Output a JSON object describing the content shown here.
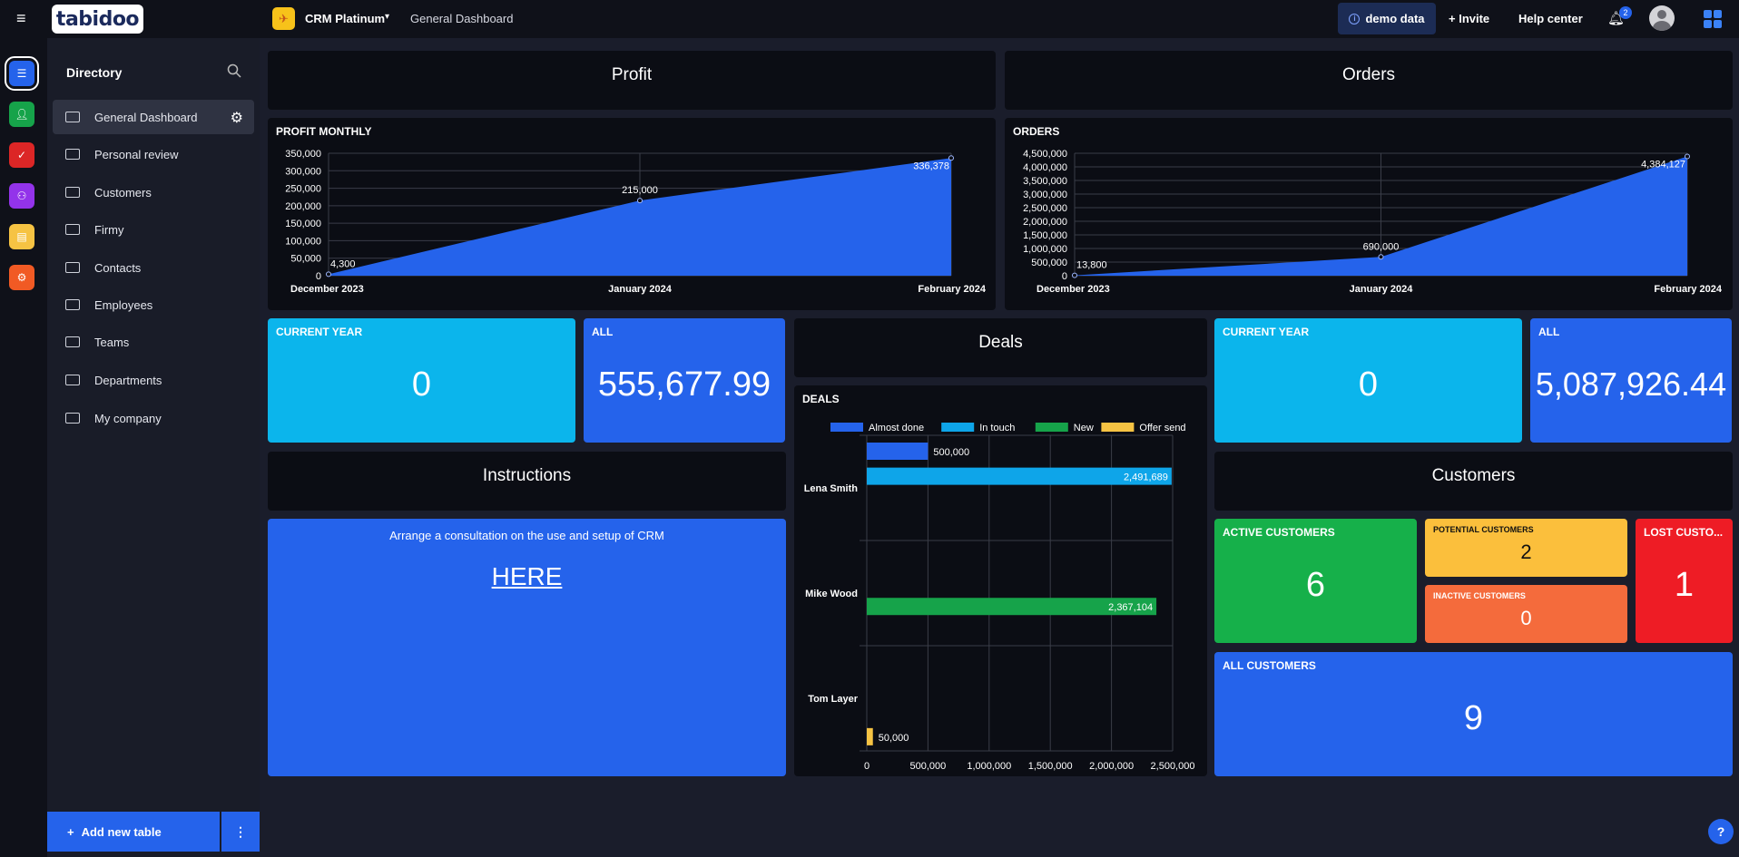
{
  "topbar": {
    "logo_text": "tabidoo",
    "app_name": "CRM Platinum",
    "breadcrumb": "General Dashboard",
    "demo_label": "demo data",
    "invite_label": "+ Invite",
    "help_label": "Help center",
    "notif_count": "2"
  },
  "sidebar": {
    "title": "Directory",
    "items": [
      {
        "label": "General Dashboard"
      },
      {
        "label": "Personal review"
      },
      {
        "label": "Customers"
      },
      {
        "label": "Firmy"
      },
      {
        "label": "Contacts"
      },
      {
        "label": "Employees"
      },
      {
        "label": "Teams"
      },
      {
        "label": "Departments"
      },
      {
        "label": "My company"
      }
    ],
    "add_table_label": "Add new table"
  },
  "rail": {
    "colors": [
      "#2563eb",
      "#16a34a",
      "#dc2626",
      "#9333ea",
      "#f6c343",
      "#f15a24"
    ]
  },
  "sections": {
    "profit_title": "Profit",
    "orders_title": "Orders",
    "deals_title": "Deals",
    "instructions_title": "Instructions",
    "customers_title": "Customers"
  },
  "kpis": {
    "profit_current_label": "CURRENT YEAR",
    "profit_current_value": "0",
    "profit_all_label": "ALL",
    "profit_all_value": "555,677.99",
    "orders_current_label": "CURRENT YEAR",
    "orders_current_value": "0",
    "orders_all_label": "ALL",
    "orders_all_value": "5,087,926.44",
    "active_label": "ACTIVE CUSTOMERS",
    "active_value": "6",
    "potential_label": "POTENTIAL CUSTOMERS",
    "potential_value": "2",
    "inactive_label": "INACTIVE CUSTOMERS",
    "inactive_value": "0",
    "lost_label": "LOST CUSTO...",
    "lost_value": "1",
    "all_customers_label": "ALL CUSTOMERS",
    "all_customers_value": "9"
  },
  "instructions": {
    "text": "Arrange a consultation on the use and setup of CRM",
    "link": "HERE"
  },
  "chart_data": [
    {
      "type": "area",
      "title": "PROFIT MONTHLY",
      "categories": [
        "December 2023",
        "January 2024",
        "February 2024"
      ],
      "values": [
        4300,
        215000,
        336378
      ],
      "value_labels": [
        "4,300",
        "215,000",
        "336,378"
      ],
      "yticks": [
        "0",
        "50,000",
        "100,000",
        "150,000",
        "200,000",
        "250,000",
        "300,000",
        "350,000"
      ],
      "ylim": [
        0,
        350000
      ],
      "color": "#2563eb"
    },
    {
      "type": "area",
      "title": "ORDERS",
      "categories": [
        "December 2023",
        "January 2024",
        "February 2024"
      ],
      "values": [
        13800,
        690000,
        4384127
      ],
      "value_labels": [
        "13,800",
        "690,000",
        "4,384,127"
      ],
      "yticks": [
        "0",
        "500,000",
        "1,000,000",
        "1,500,000",
        "2,000,000",
        "2,500,000",
        "3,000,000",
        "3,500,000",
        "4,000,000",
        "4,500,000"
      ],
      "ylim": [
        0,
        4500000
      ],
      "color": "#2563eb"
    },
    {
      "type": "bar",
      "orientation": "horizontal",
      "title": "DEALS",
      "categories": [
        "Lena Smith",
        "Mike Wood",
        "Tom Layer"
      ],
      "series": [
        {
          "name": "Almost done",
          "color": "#2563eb",
          "values": [
            500000,
            null,
            null
          ]
        },
        {
          "name": "In touch",
          "color": "#0ea5e9",
          "values": [
            2491689,
            null,
            null
          ]
        },
        {
          "name": "New",
          "color": "#16a34a",
          "values": [
            null,
            2367104,
            null
          ]
        },
        {
          "name": "Offer send",
          "color": "#f6c343",
          "values": [
            null,
            null,
            50000
          ]
        }
      ],
      "value_labels": {
        "Lena Smith": [
          "500,000",
          "2,491,689"
        ],
        "Mike Wood": [
          "2,367,104"
        ],
        "Tom Layer": [
          "50,000"
        ]
      },
      "xticks": [
        "0",
        "500,000",
        "1,000,000",
        "1,500,000",
        "2,000,000",
        "2,500,000"
      ],
      "xlim": [
        0,
        2500000
      ]
    }
  ]
}
